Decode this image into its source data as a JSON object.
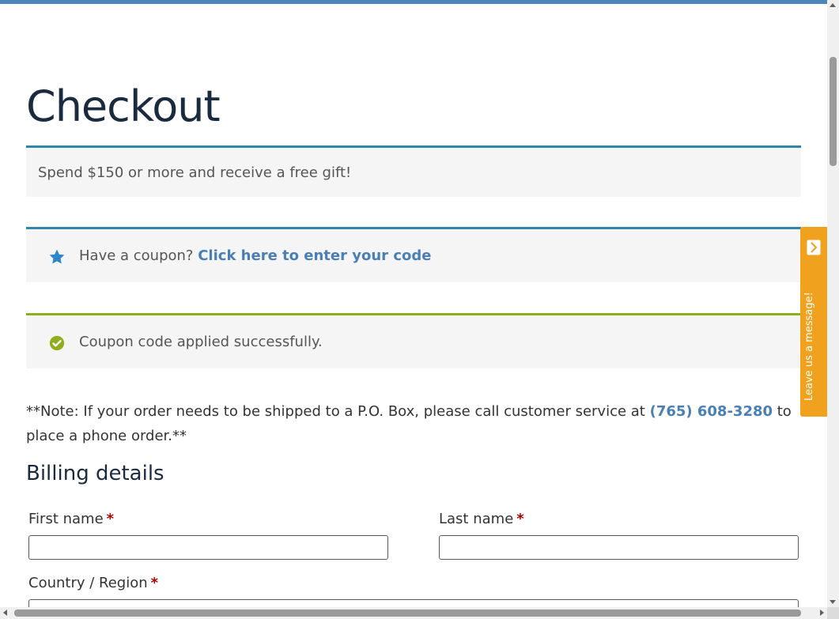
{
  "page": {
    "title": "Checkout",
    "gift_notice": "Spend $150 or more and receive a free gift!",
    "coupon": {
      "prompt": "Have a coupon?",
      "link": "Click here to enter your code"
    },
    "success_message": "Coupon code applied successfully.",
    "po_note": {
      "before": "**Note: If your order needs to be shipped to a P.O. Box, please call customer service at ",
      "phone": "(765) 608-3280",
      "after": " to place a phone order.**"
    },
    "billing": {
      "heading": "Billing details",
      "first_name_label": "First name",
      "last_name_label": "Last name",
      "country_label": "Country / Region",
      "required_mark": "*",
      "first_name_value": "",
      "last_name_value": ""
    }
  },
  "chat": {
    "label": "Leave us a message!",
    "icon": "chevron-right-icon"
  },
  "colors": {
    "accent_blue": "#2e86ab",
    "success_green": "#8fae1b",
    "link_blue": "#4a7fb5",
    "chat_orange": "#f0a21e",
    "heading_navy": "#1a2a3f"
  }
}
